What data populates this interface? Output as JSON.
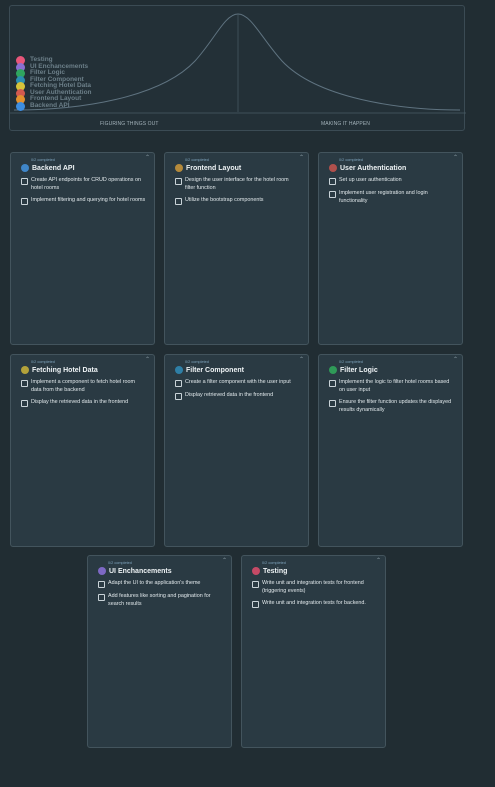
{
  "hill": {
    "left_label": "FIGURING THINGS OUT",
    "right_label": "MAKING IT HAPPEN",
    "legend": [
      {
        "label": "Testing",
        "color": "#e8567a"
      },
      {
        "label": "UI Enchancements",
        "color": "#8b6fd0"
      },
      {
        "label": "Filter Logic",
        "color": "#2fa65f"
      },
      {
        "label": "Filter Component",
        "color": "#2b8fb0"
      },
      {
        "label": "Fetching Hotel Data",
        "color": "#d6c33a"
      },
      {
        "label": "User Authentication",
        "color": "#d2594f"
      },
      {
        "label": "Frontend Layout",
        "color": "#e2902f"
      },
      {
        "label": "Backend API",
        "color": "#3e8ee0"
      }
    ]
  },
  "cards": [
    {
      "caption": "0/2 completed",
      "corner": "⌃",
      "title": "Backend API",
      "color": "#3f86c9",
      "tasks": [
        "Create API endpoints for CRUD operations on hotel rooms",
        "Implement filtering and querying for hotel rooms"
      ]
    },
    {
      "caption": "0/2 completed",
      "corner": "⌃",
      "title": "Frontend Layout",
      "color": "#b58a3b",
      "tasks": [
        "Design the user interface for the hotel room filter function",
        "Utilize the bootstrap components"
      ]
    },
    {
      "caption": "0/2 completed",
      "corner": "⌃",
      "title": "User Authentication",
      "color": "#b0504c",
      "tasks": [
        "Set up user authentication",
        "Implement user registration and login functionality"
      ]
    },
    {
      "caption": "0/2 completed",
      "corner": "⌃",
      "title": "Fetching Hotel Data",
      "color": "#b3a23a",
      "tasks": [
        "Implement a component to fetch hotel room data from the backend",
        "Display the retrieved data in the frontend"
      ]
    },
    {
      "caption": "0/2 completed",
      "corner": "⌃",
      "title": "Filter Component",
      "color": "#2e7fa6",
      "tasks": [
        "Create a filter component with the user input",
        "Display retrieved data in the frontend"
      ]
    },
    {
      "caption": "0/2 completed",
      "corner": "⌃",
      "title": "Filter Logic",
      "color": "#2f9a58",
      "tasks": [
        "Implement the logic to filter hotel rooms based on user input",
        "Ensure the filter function updates the displayed results dynamically"
      ]
    },
    {
      "caption": "0/2 completed",
      "corner": "⌃",
      "title": "UI Enchancements",
      "color": "#7d68c4",
      "tasks": [
        "Adapt the UI to the application's theme",
        "Add features like sorting and pagination for search results"
      ]
    },
    {
      "caption": "0/2 completed",
      "corner": "⌃",
      "title": "Testing",
      "color": "#c54a66",
      "tasks": [
        "Write unit and integration tests for frontend (triggering events)",
        "Write unit and integration tests for backend."
      ]
    }
  ]
}
